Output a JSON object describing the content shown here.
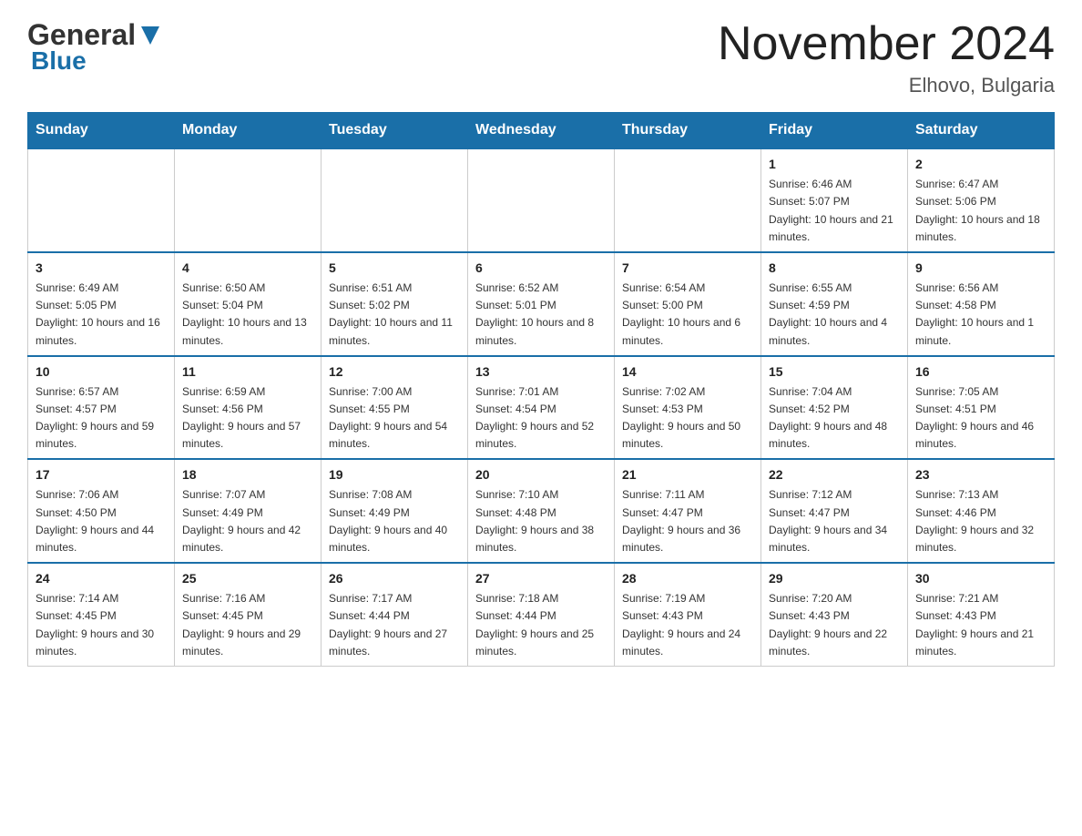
{
  "header": {
    "logo_general": "General",
    "logo_blue": "Blue",
    "month_title": "November 2024",
    "location": "Elhovo, Bulgaria"
  },
  "weekdays": [
    "Sunday",
    "Monday",
    "Tuesday",
    "Wednesday",
    "Thursday",
    "Friday",
    "Saturday"
  ],
  "weeks": [
    [
      {
        "day": "",
        "sunrise": "",
        "sunset": "",
        "daylight": ""
      },
      {
        "day": "",
        "sunrise": "",
        "sunset": "",
        "daylight": ""
      },
      {
        "day": "",
        "sunrise": "",
        "sunset": "",
        "daylight": ""
      },
      {
        "day": "",
        "sunrise": "",
        "sunset": "",
        "daylight": ""
      },
      {
        "day": "",
        "sunrise": "",
        "sunset": "",
        "daylight": ""
      },
      {
        "day": "1",
        "sunrise": "Sunrise: 6:46 AM",
        "sunset": "Sunset: 5:07 PM",
        "daylight": "Daylight: 10 hours and 21 minutes."
      },
      {
        "day": "2",
        "sunrise": "Sunrise: 6:47 AM",
        "sunset": "Sunset: 5:06 PM",
        "daylight": "Daylight: 10 hours and 18 minutes."
      }
    ],
    [
      {
        "day": "3",
        "sunrise": "Sunrise: 6:49 AM",
        "sunset": "Sunset: 5:05 PM",
        "daylight": "Daylight: 10 hours and 16 minutes."
      },
      {
        "day": "4",
        "sunrise": "Sunrise: 6:50 AM",
        "sunset": "Sunset: 5:04 PM",
        "daylight": "Daylight: 10 hours and 13 minutes."
      },
      {
        "day": "5",
        "sunrise": "Sunrise: 6:51 AM",
        "sunset": "Sunset: 5:02 PM",
        "daylight": "Daylight: 10 hours and 11 minutes."
      },
      {
        "day": "6",
        "sunrise": "Sunrise: 6:52 AM",
        "sunset": "Sunset: 5:01 PM",
        "daylight": "Daylight: 10 hours and 8 minutes."
      },
      {
        "day": "7",
        "sunrise": "Sunrise: 6:54 AM",
        "sunset": "Sunset: 5:00 PM",
        "daylight": "Daylight: 10 hours and 6 minutes."
      },
      {
        "day": "8",
        "sunrise": "Sunrise: 6:55 AM",
        "sunset": "Sunset: 4:59 PM",
        "daylight": "Daylight: 10 hours and 4 minutes."
      },
      {
        "day": "9",
        "sunrise": "Sunrise: 6:56 AM",
        "sunset": "Sunset: 4:58 PM",
        "daylight": "Daylight: 10 hours and 1 minute."
      }
    ],
    [
      {
        "day": "10",
        "sunrise": "Sunrise: 6:57 AM",
        "sunset": "Sunset: 4:57 PM",
        "daylight": "Daylight: 9 hours and 59 minutes."
      },
      {
        "day": "11",
        "sunrise": "Sunrise: 6:59 AM",
        "sunset": "Sunset: 4:56 PM",
        "daylight": "Daylight: 9 hours and 57 minutes."
      },
      {
        "day": "12",
        "sunrise": "Sunrise: 7:00 AM",
        "sunset": "Sunset: 4:55 PM",
        "daylight": "Daylight: 9 hours and 54 minutes."
      },
      {
        "day": "13",
        "sunrise": "Sunrise: 7:01 AM",
        "sunset": "Sunset: 4:54 PM",
        "daylight": "Daylight: 9 hours and 52 minutes."
      },
      {
        "day": "14",
        "sunrise": "Sunrise: 7:02 AM",
        "sunset": "Sunset: 4:53 PM",
        "daylight": "Daylight: 9 hours and 50 minutes."
      },
      {
        "day": "15",
        "sunrise": "Sunrise: 7:04 AM",
        "sunset": "Sunset: 4:52 PM",
        "daylight": "Daylight: 9 hours and 48 minutes."
      },
      {
        "day": "16",
        "sunrise": "Sunrise: 7:05 AM",
        "sunset": "Sunset: 4:51 PM",
        "daylight": "Daylight: 9 hours and 46 minutes."
      }
    ],
    [
      {
        "day": "17",
        "sunrise": "Sunrise: 7:06 AM",
        "sunset": "Sunset: 4:50 PM",
        "daylight": "Daylight: 9 hours and 44 minutes."
      },
      {
        "day": "18",
        "sunrise": "Sunrise: 7:07 AM",
        "sunset": "Sunset: 4:49 PM",
        "daylight": "Daylight: 9 hours and 42 minutes."
      },
      {
        "day": "19",
        "sunrise": "Sunrise: 7:08 AM",
        "sunset": "Sunset: 4:49 PM",
        "daylight": "Daylight: 9 hours and 40 minutes."
      },
      {
        "day": "20",
        "sunrise": "Sunrise: 7:10 AM",
        "sunset": "Sunset: 4:48 PM",
        "daylight": "Daylight: 9 hours and 38 minutes."
      },
      {
        "day": "21",
        "sunrise": "Sunrise: 7:11 AM",
        "sunset": "Sunset: 4:47 PM",
        "daylight": "Daylight: 9 hours and 36 minutes."
      },
      {
        "day": "22",
        "sunrise": "Sunrise: 7:12 AM",
        "sunset": "Sunset: 4:47 PM",
        "daylight": "Daylight: 9 hours and 34 minutes."
      },
      {
        "day": "23",
        "sunrise": "Sunrise: 7:13 AM",
        "sunset": "Sunset: 4:46 PM",
        "daylight": "Daylight: 9 hours and 32 minutes."
      }
    ],
    [
      {
        "day": "24",
        "sunrise": "Sunrise: 7:14 AM",
        "sunset": "Sunset: 4:45 PM",
        "daylight": "Daylight: 9 hours and 30 minutes."
      },
      {
        "day": "25",
        "sunrise": "Sunrise: 7:16 AM",
        "sunset": "Sunset: 4:45 PM",
        "daylight": "Daylight: 9 hours and 29 minutes."
      },
      {
        "day": "26",
        "sunrise": "Sunrise: 7:17 AM",
        "sunset": "Sunset: 4:44 PM",
        "daylight": "Daylight: 9 hours and 27 minutes."
      },
      {
        "day": "27",
        "sunrise": "Sunrise: 7:18 AM",
        "sunset": "Sunset: 4:44 PM",
        "daylight": "Daylight: 9 hours and 25 minutes."
      },
      {
        "day": "28",
        "sunrise": "Sunrise: 7:19 AM",
        "sunset": "Sunset: 4:43 PM",
        "daylight": "Daylight: 9 hours and 24 minutes."
      },
      {
        "day": "29",
        "sunrise": "Sunrise: 7:20 AM",
        "sunset": "Sunset: 4:43 PM",
        "daylight": "Daylight: 9 hours and 22 minutes."
      },
      {
        "day": "30",
        "sunrise": "Sunrise: 7:21 AM",
        "sunset": "Sunset: 4:43 PM",
        "daylight": "Daylight: 9 hours and 21 minutes."
      }
    ]
  ]
}
